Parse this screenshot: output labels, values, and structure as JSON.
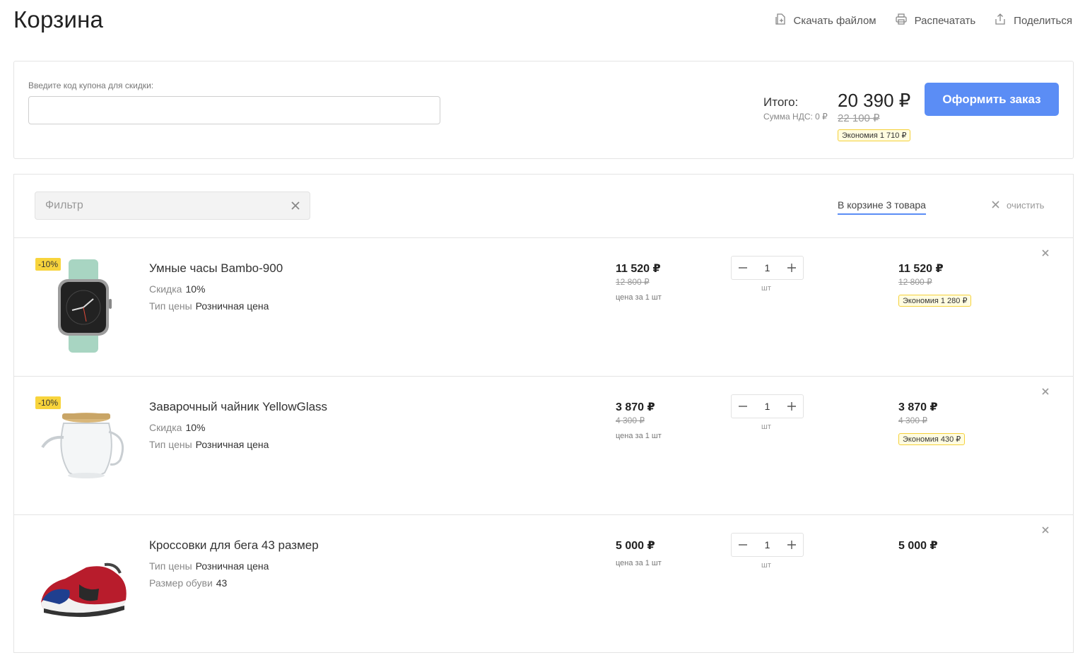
{
  "page": {
    "title": "Корзина"
  },
  "actions": [
    {
      "label": "Скачать файлом",
      "icon": "download-file-icon"
    },
    {
      "label": "Распечатать",
      "icon": "printer-icon"
    },
    {
      "label": "Поделиться",
      "icon": "share-icon"
    }
  ],
  "summary": {
    "coupon_label": "Введите код купона для скидки:",
    "coupon_value": "",
    "total_label": "Итого:",
    "vat_label": "Сумма НДС: 0 ₽",
    "total_price": "20 390 ₽",
    "total_old": "22 100 ₽",
    "total_saving": "Экономия  1 710 ₽",
    "checkout_label": "Оформить заказ"
  },
  "cart": {
    "filter_placeholder": "Фильтр",
    "count_label": "В корзине 3 товара",
    "clear_label": "очистить",
    "items": [
      {
        "discount_badge": "-10%",
        "name": "Умные часы Bambo-900",
        "props": [
          {
            "label": "Скидка",
            "value": "10%"
          },
          {
            "label": "Тип цены",
            "value": "Розничная цена"
          }
        ],
        "unit_price": "11 520 ₽",
        "unit_old": "12 800 ₽",
        "per_unit": "цена за 1 шт",
        "qty": "1",
        "qty_unit": "шт",
        "sum_price": "11 520 ₽",
        "sum_old": "12 800 ₽",
        "sum_saving": "Экономия  1 280 ₽"
      },
      {
        "discount_badge": "-10%",
        "name": "Заварочный чайник YellowGlass",
        "props": [
          {
            "label": "Скидка",
            "value": "10%"
          },
          {
            "label": "Тип цены",
            "value": "Розничная цена"
          }
        ],
        "unit_price": "3 870 ₽",
        "unit_old": "4 300 ₽",
        "per_unit": "цена за 1 шт",
        "qty": "1",
        "qty_unit": "шт",
        "sum_price": "3 870 ₽",
        "sum_old": "4 300 ₽",
        "sum_saving": "Экономия  430 ₽"
      },
      {
        "name": "Кроссовки для бега 43 размер",
        "props": [
          {
            "label": "Тип цены",
            "value": "Розничная цена"
          },
          {
            "label": "Размер обуви",
            "value": "43"
          }
        ],
        "unit_price": "5 000 ₽",
        "per_unit": "цена за 1 шт",
        "qty": "1",
        "qty_unit": "шт",
        "sum_price": "5 000 ₽"
      }
    ]
  },
  "colors": {
    "accent": "#5b8df5",
    "badge_yellow": "#f8d43c",
    "saving_bg": "#fffce0",
    "border": "#e4e4e4"
  }
}
